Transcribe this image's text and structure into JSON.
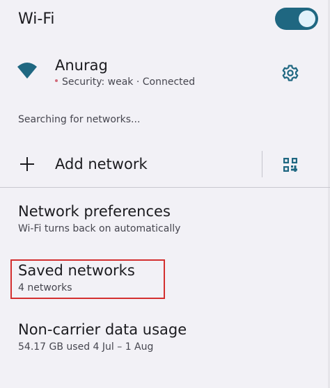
{
  "wifi": {
    "title": "Wi-Fi",
    "enabled": true
  },
  "connected_network": {
    "name": "Anurag",
    "status": "Security: weak · Connected",
    "icon": "wifi-signal-icon"
  },
  "searching_text": "Searching for networks...",
  "add_network": {
    "label": "Add network",
    "icon": "plus-icon",
    "qr_icon": "qr-code-scan-icon"
  },
  "preferences": [
    {
      "title": "Network preferences",
      "summary": "Wi-Fi turns back on automatically"
    },
    {
      "title": "Saved networks",
      "summary": "4 networks"
    },
    {
      "title": "Non-carrier data usage",
      "summary": "54.17 GB used 4 Jul – 1 Aug"
    }
  ],
  "colors": {
    "background": "#f2f1f6",
    "accent": "#1f6781",
    "highlight_box": "#d32f2f",
    "weak_security_dot": "#d16b7b"
  }
}
